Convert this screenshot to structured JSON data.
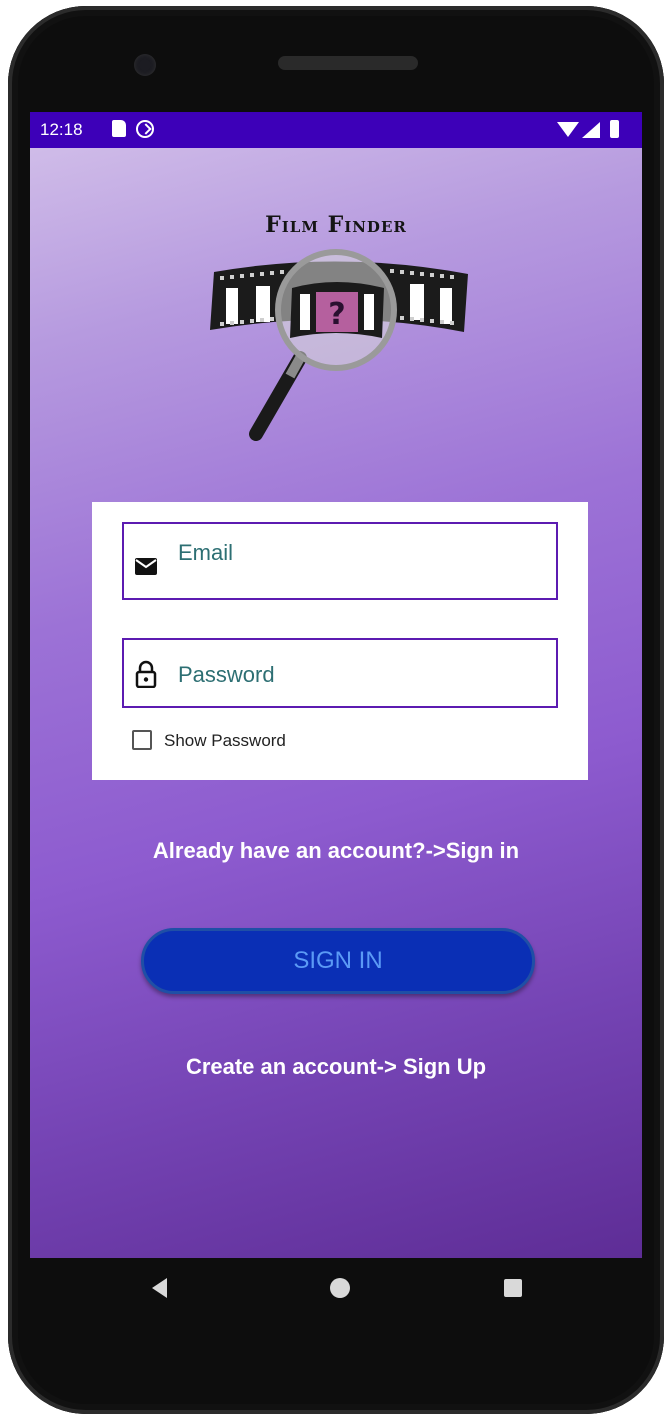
{
  "status_bar": {
    "time": "12:18",
    "icons": [
      "sd-card-icon",
      "data-saver-icon",
      "wifi-icon",
      "signal-icon",
      "battery-icon"
    ]
  },
  "logo": {
    "title": "Film Finder",
    "question_mark": "?"
  },
  "form": {
    "email_placeholder": "Email",
    "password_placeholder": "Password",
    "show_password_label": "Show Password",
    "show_password_checked": false
  },
  "links": {
    "sign_in_text": "Already have an account?->Sign in",
    "sign_up_text": "Create an account-> Sign Up"
  },
  "buttons": {
    "sign_in_label": "SIGN IN"
  },
  "nav_bar": {
    "buttons": [
      "back-icon",
      "home-icon",
      "recents-icon"
    ]
  },
  "colors": {
    "status_bar": "#3d00b8",
    "gradient_top": "#d4c2ea",
    "gradient_bottom": "#5e2d96",
    "field_border": "#5c1bb1",
    "field_text": "#2d6f73",
    "button_fill": "#0a2fb5",
    "button_text": "#5b9af5"
  }
}
